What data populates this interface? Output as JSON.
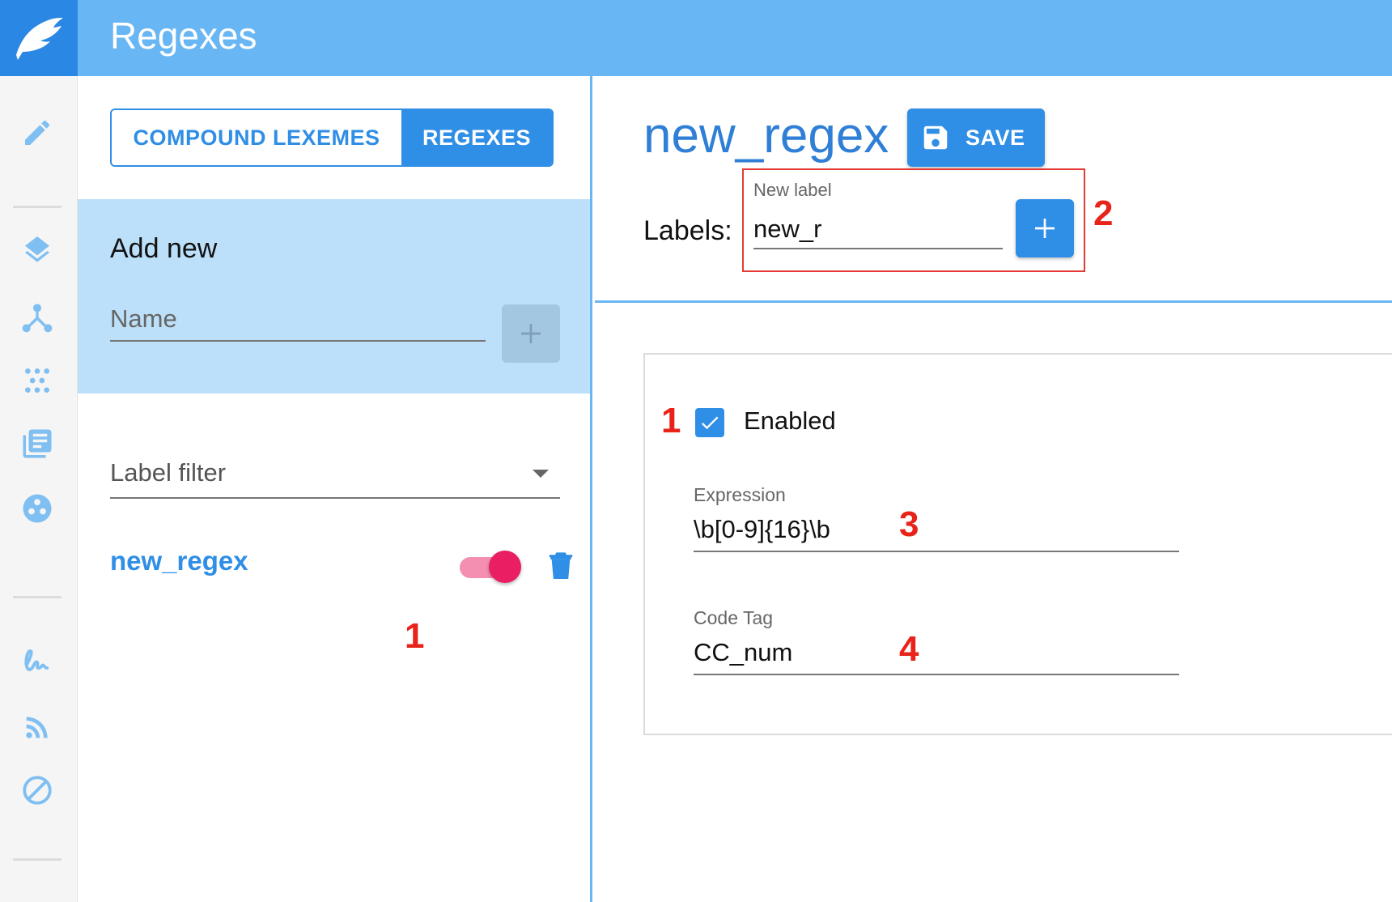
{
  "header": {
    "title": "Regexes",
    "logo_icon": "bird-feather-logo-icon"
  },
  "rail": {
    "icons": [
      "pencil-icon",
      "layers-icon",
      "network-icon",
      "dots-grid-icon",
      "list-icon",
      "palette-icon",
      "signature-icon",
      "rss-icon",
      "block-icon"
    ]
  },
  "tabs": {
    "compound": "COMPOUND LEXEMES",
    "regexes": "REGEXES",
    "active": "regexes"
  },
  "add_new": {
    "title": "Add new",
    "name_placeholder": "Name"
  },
  "filter": {
    "label": "Label filter"
  },
  "list": {
    "items": [
      {
        "name": "new_regex",
        "enabled": true
      }
    ]
  },
  "detail": {
    "title": "new_regex",
    "save_label": "SAVE",
    "labels_caption": "Labels:",
    "new_label_caption": "New label",
    "new_label_value": "new_r",
    "enabled_label": "Enabled",
    "enabled": true,
    "expression_caption": "Expression",
    "expression_value": "\\b[0-9]{16}\\b",
    "code_tag_caption": "Code Tag",
    "code_tag_value": "CC_num"
  },
  "annotations": {
    "toggle": "1",
    "new_label": "2",
    "checkbox": "1",
    "expression": "3",
    "code_tag": "4"
  },
  "colors": {
    "topbar": "#68b6f4",
    "primary": "#2f8ee5",
    "toggle": "#e91e63",
    "annotation": "#e8231a"
  }
}
